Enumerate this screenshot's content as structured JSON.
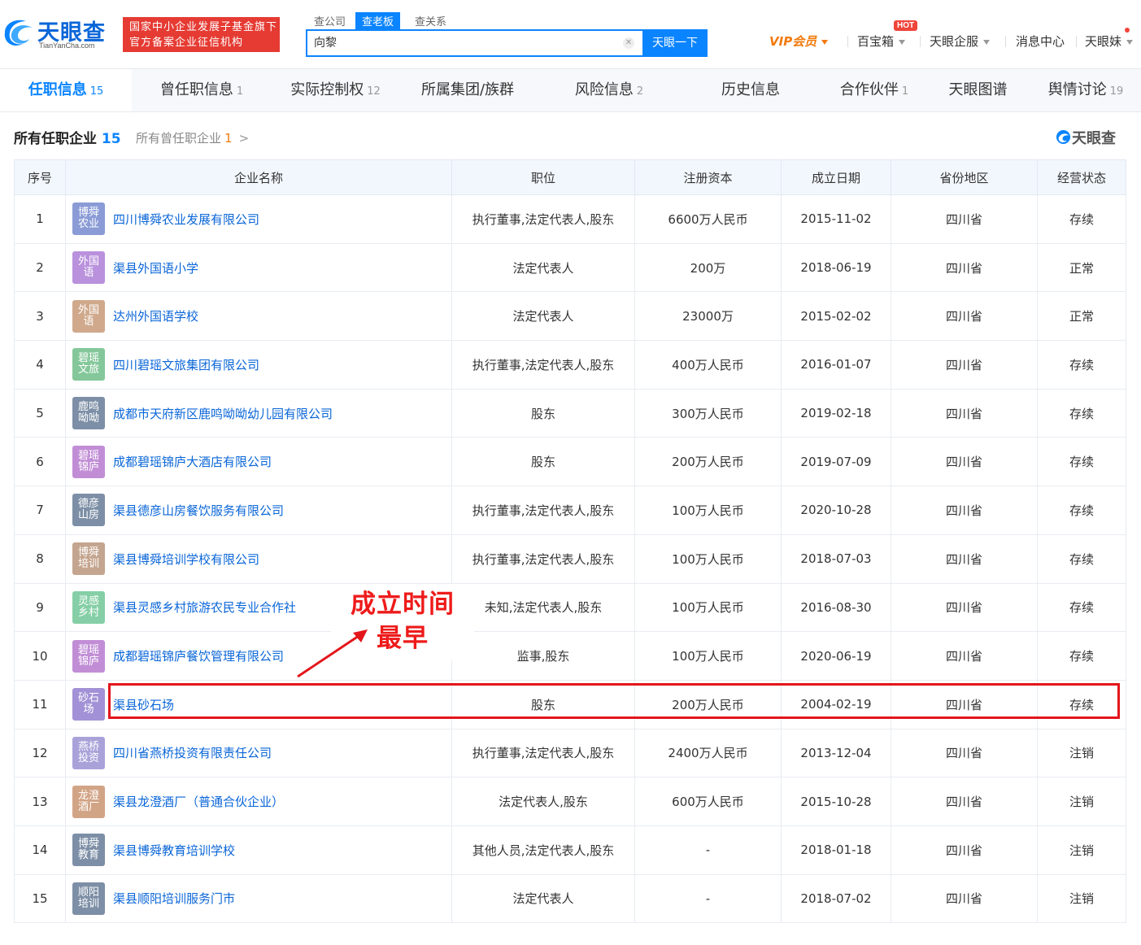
{
  "header": {
    "logo_text": "天眼查",
    "logo_sub": "TianYanCha.com",
    "gov_badge_line1": "国家中小企业发展子基金旗下",
    "gov_badge_line2": "官方备案企业征信机构",
    "search_tabs": [
      "查公司",
      "查老板",
      "查关系"
    ],
    "search_value": "向黎",
    "search_button": "天眼一下",
    "nav": {
      "vip": "VIP会员",
      "baobao": "百宝箱",
      "hot": "HOT",
      "qifu": "天眼企服",
      "messages": "消息中心",
      "mei": "天眼妹"
    },
    "colors": {
      "brand_blue": "#0a84ff",
      "badge_red": "#e53b33",
      "vip_orange": "#f27a0c"
    }
  },
  "tabs": [
    {
      "label": "任职信息",
      "count": "15"
    },
    {
      "label": "曾任职信息",
      "count": "1"
    },
    {
      "label": "实际控制权",
      "count": "12"
    },
    {
      "label": "所属集团/族群",
      "count": ""
    },
    {
      "label": "风险信息",
      "count": "2"
    },
    {
      "label": "历史信息",
      "count": ""
    },
    {
      "label": "合作伙伴",
      "count": "1"
    },
    {
      "label": "天眼图谱",
      "count": ""
    },
    {
      "label": "舆情讨论",
      "count": "19"
    }
  ],
  "section": {
    "title": "所有任职企业",
    "count": "15",
    "link_label": "所有曾任职企业",
    "link_count": "1",
    "watermark": "天眼查"
  },
  "table": {
    "headers": [
      "序号",
      "企业名称",
      "职位",
      "注册资本",
      "成立日期",
      "省份地区",
      "经营状态"
    ],
    "rows": [
      {
        "no": "1",
        "logo": "博舜\n农业",
        "logo_color": "#8a9bd6",
        "name": "四川博舜农业发展有限公司",
        "position": "执行董事,法定代表人,股东",
        "capital": "6600万人民币",
        "date": "2015-11-02",
        "region": "四川省",
        "status": "存续",
        "status_color": "green"
      },
      {
        "no": "2",
        "logo": "外国\n语",
        "logo_color": "#b991dc",
        "name": "渠县外国语小学",
        "position": "法定代表人",
        "capital": "200万",
        "date": "2018-06-19",
        "region": "四川省",
        "status": "正常",
        "status_color": "green"
      },
      {
        "no": "3",
        "logo": "外国\n语",
        "logo_color": "#d0a98c",
        "name": "达州外国语学校",
        "position": "法定代表人",
        "capital": "23000万",
        "date": "2015-02-02",
        "region": "四川省",
        "status": "正常",
        "status_color": "green"
      },
      {
        "no": "4",
        "logo": "碧瑶\n文旅",
        "logo_color": "#84c79a",
        "name": "四川碧瑶文旅集团有限公司",
        "position": "执行董事,法定代表人,股东",
        "capital": "400万人民币",
        "date": "2016-01-07",
        "region": "四川省",
        "status": "存续",
        "status_color": "green"
      },
      {
        "no": "5",
        "logo": "鹿鸣\n呦呦",
        "logo_color": "#7d8fa6",
        "name": "成都市天府新区鹿鸣呦呦幼儿园有限公司",
        "position": "股东",
        "capital": "300万人民币",
        "date": "2019-02-18",
        "region": "四川省",
        "status": "存续",
        "status_color": "green"
      },
      {
        "no": "6",
        "logo": "碧瑶\n锦庐",
        "logo_color": "#c18ed6",
        "name": "成都碧瑶锦庐大酒店有限公司",
        "position": "股东",
        "capital": "200万人民币",
        "date": "2019-07-09",
        "region": "四川省",
        "status": "存续",
        "status_color": "green"
      },
      {
        "no": "7",
        "logo": "德彦\n山房",
        "logo_color": "#7d8fa6",
        "name": "渠县德彦山房餐饮服务有限公司",
        "position": "执行董事,法定代表人,股东",
        "capital": "100万人民币",
        "date": "2020-10-28",
        "region": "四川省",
        "status": "存续",
        "status_color": "green"
      },
      {
        "no": "8",
        "logo": "博舜\n培训",
        "logo_color": "#c4a58f",
        "name": "渠县博舜培训学校有限公司",
        "position": "执行董事,法定代表人,股东",
        "capital": "100万人民币",
        "date": "2018-07-03",
        "region": "四川省",
        "status": "存续",
        "status_color": "green"
      },
      {
        "no": "9",
        "logo": "灵感\n乡村",
        "logo_color": "#86cfa6",
        "name": "渠县灵感乡村旅游农民专业合作社",
        "position": "未知,法定代表人,股东",
        "capital": "100万人民币",
        "date": "2016-08-30",
        "region": "四川省",
        "status": "存续",
        "status_color": "green"
      },
      {
        "no": "10",
        "logo": "碧瑶\n锦庐",
        "logo_color": "#c18ed6",
        "name": "成都碧瑶锦庐餐饮管理有限公司",
        "position": "监事,股东",
        "capital": "100万人民币",
        "date": "2020-06-19",
        "region": "四川省",
        "status": "存续",
        "status_color": "green"
      },
      {
        "no": "11",
        "logo": "砂石\n场",
        "logo_color": "#a291d6",
        "name": "渠县砂石场",
        "position": "股东",
        "capital": "200万人民币",
        "date": "2004-02-19",
        "region": "四川省",
        "status": "存续",
        "status_color": "green"
      },
      {
        "no": "12",
        "logo": "燕桥\n投资",
        "logo_color": "#a9a2d9",
        "name": "四川省燕桥投资有限责任公司",
        "position": "执行董事,法定代表人,股东",
        "capital": "2400万人民币",
        "date": "2013-12-04",
        "region": "四川省",
        "status": "注销",
        "status_color": "red"
      },
      {
        "no": "13",
        "logo": "龙澄\n酒厂",
        "logo_color": "#d2a486",
        "name": "渠县龙澄酒厂（普通合伙企业）",
        "position": "法定代表人,股东",
        "capital": "600万人民币",
        "date": "2015-10-28",
        "region": "四川省",
        "status": "注销",
        "status_color": "red"
      },
      {
        "no": "14",
        "logo": "博舜\n教育",
        "logo_color": "#7d8fa6",
        "name": "渠县博舜教育培训学校",
        "position": "其他人员,法定代表人,股东",
        "capital": "-",
        "date": "2018-01-18",
        "region": "四川省",
        "status": "注销",
        "status_color": "red"
      },
      {
        "no": "15",
        "logo": "顺阳\n培训",
        "logo_color": "#7d8fa6",
        "name": "渠县顺阳培训服务门市",
        "position": "法定代表人",
        "capital": "-",
        "date": "2018-07-02",
        "region": "四川省",
        "status": "注销",
        "status_color": "red"
      }
    ]
  },
  "annotation": {
    "line1": "成立时间",
    "line2": "最早",
    "color": "#ee1b1b"
  }
}
